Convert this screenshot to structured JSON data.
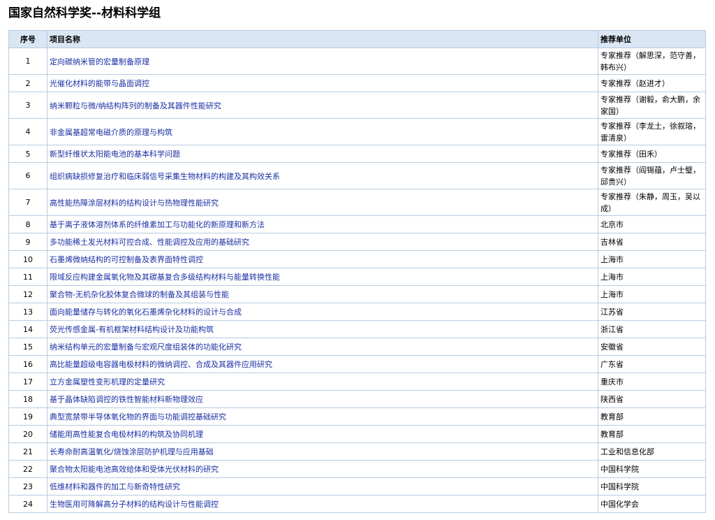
{
  "page": {
    "title": "国家自然科学奖--材料科学组"
  },
  "table": {
    "headers": [
      "序号",
      "项目名称",
      "推荐单位"
    ],
    "rows": [
      [
        "1",
        "定向碳纳米管的宏量制备原理",
        "专家推荐（解思深，范守善，韩布兴）"
      ],
      [
        "2",
        "光催化材料的能带与晶面调控",
        "专家推荐（赵进才）"
      ],
      [
        "3",
        "纳米颗粒与微/纳结构阵列的制备及其器件性能研究",
        "专家推荐（谢毅，俞大鹏，余家国）"
      ],
      [
        "4",
        "非金属基超常电磁介质的原理与构筑",
        "专家推荐（李龙土，徐叙瑢，雷清泉）"
      ],
      [
        "5",
        "新型纤维状太阳能电池的基本科学问题",
        "专家推荐（田禾）"
      ],
      [
        "6",
        "组织病缺损修复治疗和临床弱信号采集生物材料的构建及其构效关系",
        "专家推荐（阎锡蕴，卢士璧，邱贵兴）"
      ],
      [
        "7",
        "高性能热障涂层材料的结构设计与热物理性能研究",
        "专家推荐（朱静，周玉，吴以成）"
      ],
      [
        "8",
        "基于离子液体溶剂体系的纤维素加工与功能化的新原理和新方法",
        "北京市"
      ],
      [
        "9",
        "多功能稀土发光材料可控合成、性能调控及应用的基础研究",
        "吉林省"
      ],
      [
        "10",
        "石墨烯微纳结构的可控制备及表界面特性调控",
        "上海市"
      ],
      [
        "11",
        "限域反应构建金属氧化物及其碳基复合多级结构材料与能量转换性能",
        "上海市"
      ],
      [
        "12",
        "聚合物-无机杂化胶体复合微球的制备及其组装与性能",
        "上海市"
      ],
      [
        "13",
        "面向能量储存与转化的氧化石墨烯杂化材料的设计与合成",
        "江苏省"
      ],
      [
        "14",
        "荧光传感金属-有机框架材料结构设计及功能构筑",
        "浙江省"
      ],
      [
        "15",
        "纳米结构单元的宏量制备与宏观尺度组装体的功能化研究",
        "安徽省"
      ],
      [
        "16",
        "高比能量超级电容器电极材料的微纳调控、合成及其器件应用研究",
        "广东省"
      ],
      [
        "17",
        "立方金属塑性变形机理的定量研究",
        "重庆市"
      ],
      [
        "18",
        "基于晶体缺陷调控的铁性智能材料新物理效应",
        "陕西省"
      ],
      [
        "19",
        "典型宽禁带半导体氧化物的界面与功能调控基础研究",
        "教育部"
      ],
      [
        "20",
        "储能用高性能复合电极材料的构筑及协同机理",
        "教育部"
      ],
      [
        "21",
        "长寿命耐高温氧化/烧蚀涂层防护机理与应用基础",
        "工业和信息化部"
      ],
      [
        "22",
        "聚合物太阳能电池高效给体和受体光伏材料的研究",
        "中国科学院"
      ],
      [
        "23",
        "低维材料和器件的加工与新奇特性研究",
        "中国科学院"
      ],
      [
        "24",
        "生物医用可降解高分子材料的结构设计与性能调控",
        "中国化学会"
      ]
    ]
  }
}
